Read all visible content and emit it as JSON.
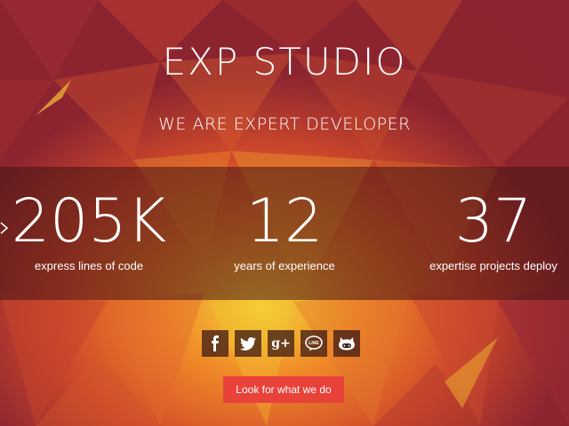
{
  "hero": {
    "title": "EXP STUDIO",
    "subtitle": "WE ARE EXPERT DEVELOPER"
  },
  "stats": [
    {
      "value": "205K",
      "label": "express lines of code"
    },
    {
      "value": "12",
      "label": "years of experience"
    },
    {
      "value": "37",
      "label": "expertise projects deploy"
    }
  ],
  "social": [
    {
      "icon": "facebook-icon"
    },
    {
      "icon": "twitter-icon"
    },
    {
      "icon": "google-plus-icon",
      "text": "g+"
    },
    {
      "icon": "line-icon",
      "text": "LINE"
    },
    {
      "icon": "github-icon"
    }
  ],
  "cta": {
    "label": "Look for what we do"
  },
  "colors": {
    "background": "#b83a2a",
    "accent": "#e8423a",
    "band": "#461414"
  }
}
